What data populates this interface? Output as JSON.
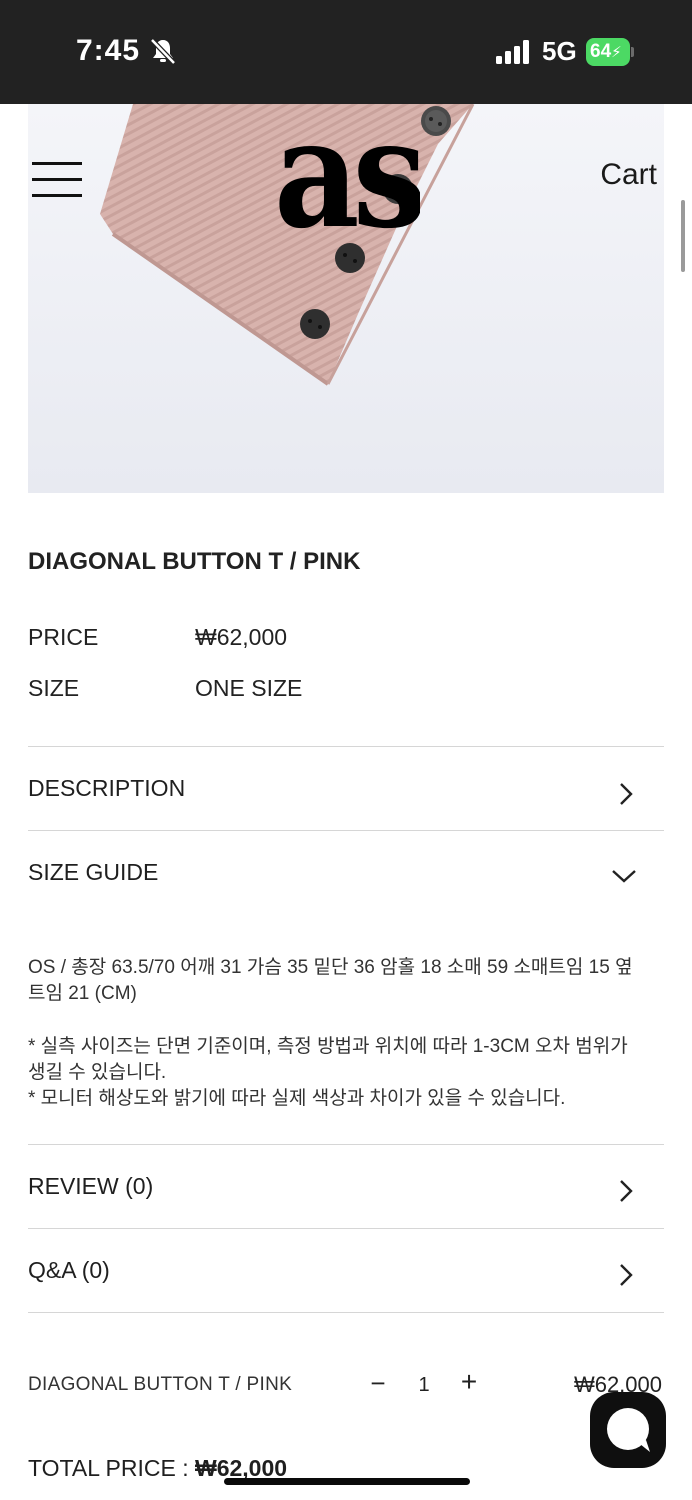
{
  "status_bar": {
    "time": "7:45",
    "network": "5G",
    "battery": "64"
  },
  "header": {
    "logo_alt": "as",
    "cart_label": "Cart"
  },
  "product": {
    "title": "DIAGONAL BUTTON T / PINK",
    "price_label": "PRICE",
    "price_value": "₩62,000",
    "size_label": "SIZE",
    "size_value": "ONE SIZE"
  },
  "sections": {
    "description": "DESCRIPTION",
    "size_guide": "SIZE GUIDE",
    "size_guide_line1": "OS / 총장 63.5/70 어깨 31 가슴 35 밑단 36 암홀 18 소매 59 소매트임 15 옆트임 21 (CM)",
    "size_guide_note1": "* 실측 사이즈는 단면 기준이며, 측정 방법과 위치에 따라 1-3CM 오차 범위가 생길 수 있습니다.",
    "size_guide_note2": "* 모니터 해상도와 밝기에 따라 실제 색상과 차이가 있을 수 있습니다.",
    "review": "REVIEW (0)",
    "qna": "Q&A (0)"
  },
  "order": {
    "item_name": "DIAGONAL BUTTON T / PINK",
    "minus": "−",
    "quantity": "1",
    "plus": "+",
    "item_price": "₩62,000",
    "total_label": "TOTAL PRICE : ",
    "total_value": "₩62,000"
  },
  "colors": {
    "status_bar_bg": "#222222",
    "battery_green": "#4cd964",
    "shirt_pink": "#d8b3ad",
    "button_dark": "#3a3a3a"
  },
  "icons": [
    "bell-slash-icon",
    "signal-icon",
    "battery-icon",
    "menu-icon",
    "chevron-right-icon",
    "chevron-down-icon",
    "chat-icon"
  ]
}
